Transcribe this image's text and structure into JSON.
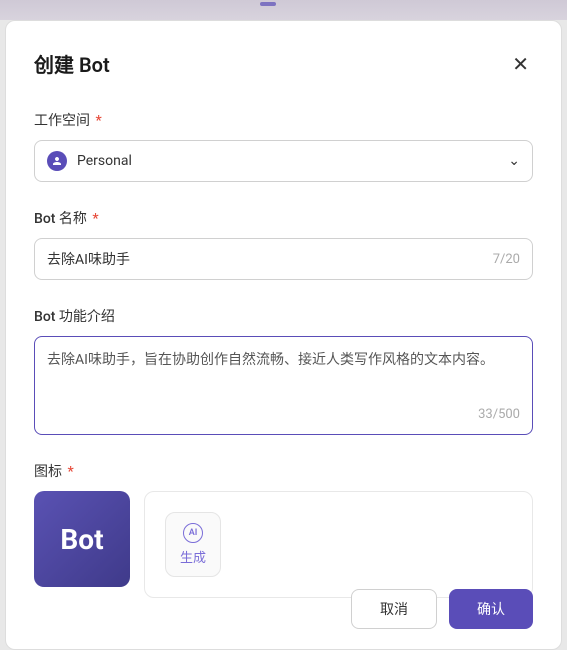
{
  "modal": {
    "title": "创建 Bot"
  },
  "workspace": {
    "label": "工作空间",
    "value": "Personal"
  },
  "botName": {
    "label": "Bot 名称",
    "value": "去除AI味助手",
    "count": "7/20"
  },
  "botDesc": {
    "label": "Bot 功能介绍",
    "value": "去除AI味助手，旨在协助创作自然流畅、接近人类写作风格的文本内容。",
    "count": "33/500"
  },
  "icon": {
    "label": "图标",
    "preview": "Bot",
    "generateLabel": "生成",
    "aiLabel": "AI"
  },
  "footer": {
    "cancel": "取消",
    "confirm": "确认"
  }
}
